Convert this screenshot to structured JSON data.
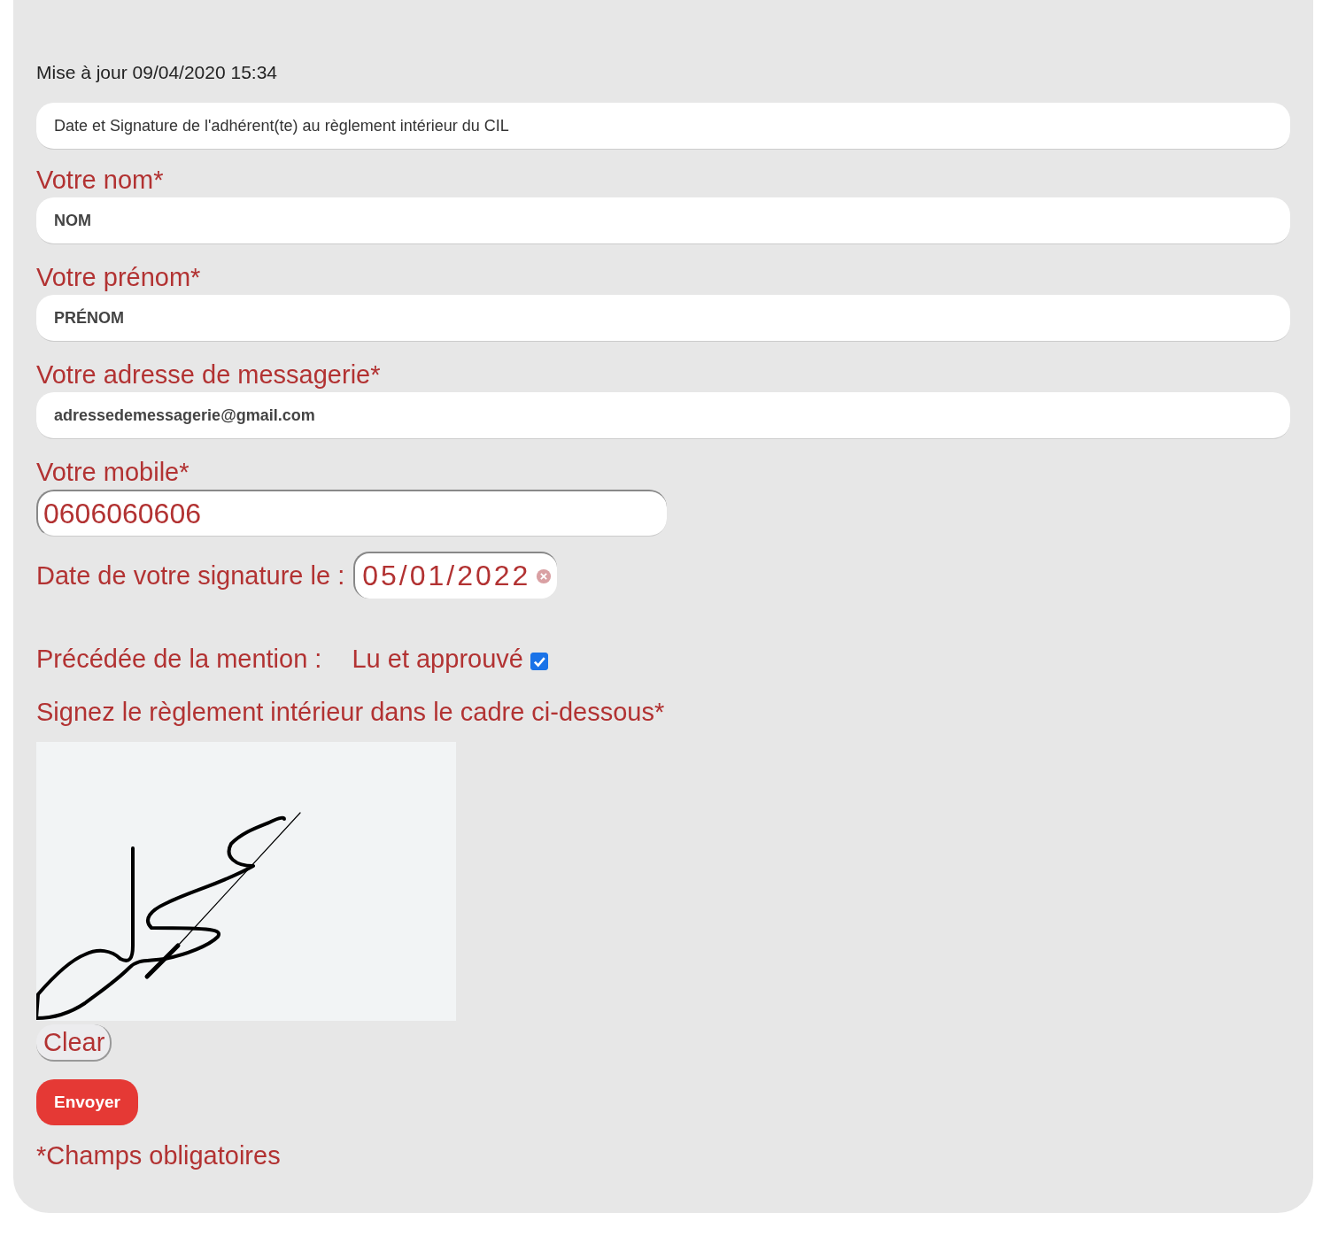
{
  "updated": "Mise à jour 09/04/2020 15:34",
  "subject_field": {
    "value": "Date et Signature de l'adhérent(te) au règlement intérieur du CIL"
  },
  "fields": [
    {
      "label": "Votre nom*",
      "value": "NOM",
      "kind": "text"
    },
    {
      "label": "Votre prénom*",
      "value": "PRÉNOM",
      "kind": "text"
    },
    {
      "label": "Votre adresse de messagerie*",
      "value": "adressedemessagerie@gmail.com",
      "kind": "text"
    },
    {
      "label": "Votre mobile*",
      "value": "0606060606",
      "kind": "tel"
    }
  ],
  "date": {
    "label": "Date de votre signature le :",
    "value": "05/01/2022"
  },
  "mention": {
    "label": "Précédée de la mention :",
    "option": "Lu et approuvé",
    "checked": true
  },
  "signature": {
    "label": "Signez le règlement intérieur dans le cadre ci-dessous*"
  },
  "clear_button": "Clear",
  "submit_button": "Envoyer",
  "footnote": "*Champs obligatoires"
}
